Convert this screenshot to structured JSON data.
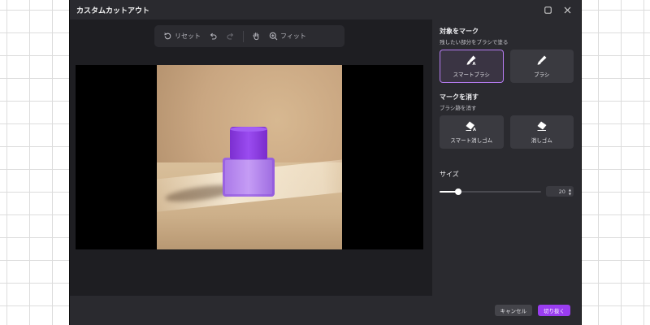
{
  "window": {
    "title": "カスタムカットアウト"
  },
  "toolbar": {
    "reset_label": "リセット",
    "fit_label": "フィット",
    "icons": [
      "reset-icon",
      "undo-icon",
      "redo-icon",
      "hand-icon",
      "zoom-in-icon"
    ]
  },
  "panel": {
    "mark_title": "対象をマーク",
    "mark_subtitle": "残したい部分をブラシで塗る",
    "smart_brush_label": "スマートブラシ",
    "brush_label": "ブラシ",
    "erase_title": "マークを消す",
    "erase_subtitle": "ブラシ跡を消す",
    "smart_eraser_label": "スマート消しゴム",
    "eraser_label": "消しゴム",
    "size_label": "サイズ",
    "size_value": "20",
    "size_fraction": 0.18
  },
  "footer": {
    "cancel_label": "キャンセル",
    "cutout_label": "切り抜く"
  },
  "colors": {
    "accent": "#9a3df0",
    "active_border": "#b67cf2",
    "panel_bg": "#2a2a2f",
    "canvas_bg": "#1e1e22"
  }
}
